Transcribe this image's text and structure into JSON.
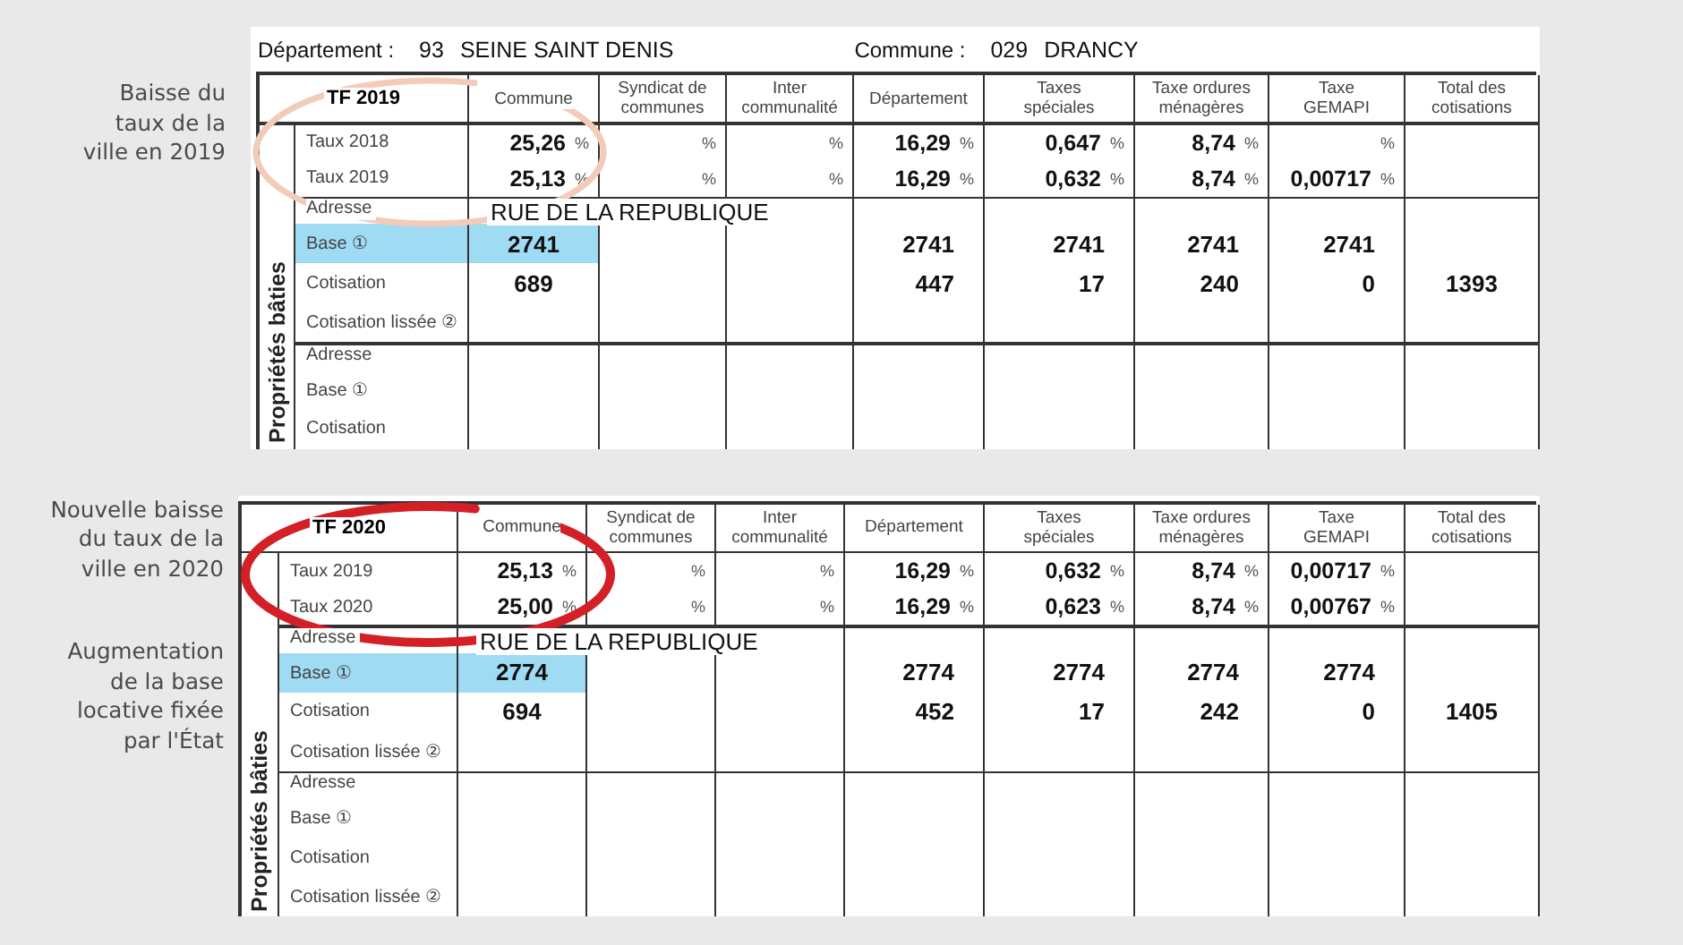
{
  "sections": [
    {
      "annotations": [
        {
          "lines": [
            "Baisse du",
            "taux de la",
            "ville en 2019"
          ]
        }
      ],
      "panel": {
        "header": {
          "departement_label": "Département :",
          "departement_code": "93",
          "departement_name": "SEINE SAINT DENIS",
          "commune_label": "Commune :",
          "commune_code": "029",
          "commune_name": "DRANCY"
        },
        "circle": {
          "color": "#f3cbb9"
        },
        "title": "TF 2019",
        "columns": [
          {
            "lines": [
              "Commune"
            ]
          },
          {
            "lines": [
              "Syndicat de",
              "communes"
            ]
          },
          {
            "lines": [
              "Inter",
              "communalité"
            ]
          },
          {
            "lines": [
              "Département"
            ]
          },
          {
            "lines": [
              "Taxes",
              "spéciales"
            ]
          },
          {
            "lines": [
              "Taxe ordures",
              "ménagères"
            ]
          },
          {
            "lines": [
              "Taxe",
              "GEMAPI"
            ]
          },
          {
            "lines": [
              "Total des",
              "cotisations"
            ]
          }
        ],
        "side_label": "Propriétés bâties",
        "rate_rows": [
          {
            "label": "Taux 2018",
            "cells": [
              {
                "value": "25,26",
                "unit": "%"
              },
              {
                "unit": "%"
              },
              {
                "unit": "%"
              },
              {
                "value": "16,29",
                "unit": "%"
              },
              {
                "value": "0,647",
                "unit": "%"
              },
              {
                "value": "8,74",
                "unit": "%"
              },
              {
                "unit": "%"
              },
              {}
            ]
          },
          {
            "label": "Taux 2019",
            "cells": [
              {
                "value": "25,13",
                "unit": "%"
              },
              {
                "unit": "%"
              },
              {
                "unit": "%"
              },
              {
                "value": "16,29",
                "unit": "%"
              },
              {
                "value": "0,632",
                "unit": "%"
              },
              {
                "value": "8,74",
                "unit": "%"
              },
              {
                "value": "0,00717",
                "unit": "%"
              },
              {}
            ]
          }
        ],
        "blocks": [
          {
            "address_label": "Adresse",
            "address": "RUE DE LA REPUBLIQUE",
            "rows": [
              {
                "label": "Base ①",
                "highlighted": true,
                "cells": [
                  {
                    "value": "2741"
                  },
                  {},
                  {},
                  {
                    "value": "2741"
                  },
                  {
                    "value": "2741"
                  },
                  {
                    "value": "2741"
                  },
                  {
                    "value": "2741"
                  },
                  {}
                ]
              },
              {
                "label": "Cotisation",
                "highlighted": false,
                "cells": [
                  {
                    "value": "689"
                  },
                  {},
                  {},
                  {
                    "value": "447"
                  },
                  {
                    "value": "17"
                  },
                  {
                    "value": "240"
                  },
                  {
                    "value": "0"
                  },
                  {
                    "value": "1393"
                  }
                ]
              },
              {
                "label": "Cotisation lissée ②",
                "highlighted": false
              }
            ]
          },
          {
            "address_label": "Adresse",
            "rows": [
              {
                "label": "Base ①",
                "highlighted": false
              },
              {
                "label": "Cotisation",
                "highlighted": false
              }
            ]
          }
        ]
      }
    },
    {
      "annotations": [
        {
          "lines": [
            "Nouvelle baisse",
            "du taux de la",
            "ville en 2020"
          ]
        },
        {
          "lines": [
            "Augmentation",
            "de la base",
            "locative fixée",
            "par l'État"
          ]
        }
      ],
      "panel": {
        "circle": {
          "color": "#d32027"
        },
        "title": "TF 2020",
        "columns": [
          {
            "lines": [
              "Commune"
            ]
          },
          {
            "lines": [
              "Syndicat de",
              "communes"
            ]
          },
          {
            "lines": [
              "Inter",
              "communalité"
            ]
          },
          {
            "lines": [
              "Département"
            ]
          },
          {
            "lines": [
              "Taxes",
              "spéciales"
            ]
          },
          {
            "lines": [
              "Taxe ordures",
              "ménagères"
            ]
          },
          {
            "lines": [
              "Taxe",
              "GEMAPI"
            ]
          },
          {
            "lines": [
              "Total des",
              "cotisations"
            ]
          }
        ],
        "side_label": "Propriétés bâties",
        "rate_rows": [
          {
            "label": "Taux 2019",
            "cells": [
              {
                "value": "25,13",
                "unit": "%"
              },
              {
                "unit": "%"
              },
              {
                "unit": "%"
              },
              {
                "value": "16,29",
                "unit": "%"
              },
              {
                "value": "0,632",
                "unit": "%"
              },
              {
                "value": "8,74",
                "unit": "%"
              },
              {
                "value": "0,00717",
                "unit": "%"
              },
              {}
            ]
          },
          {
            "label": "Taux 2020",
            "cells": [
              {
                "value": "25,00",
                "unit": "%"
              },
              {
                "unit": "%"
              },
              {
                "unit": "%"
              },
              {
                "value": "16,29",
                "unit": "%"
              },
              {
                "value": "0,623",
                "unit": "%"
              },
              {
                "value": "8,74",
                "unit": "%"
              },
              {
                "value": "0,00767",
                "unit": "%"
              },
              {}
            ]
          }
        ],
        "blocks": [
          {
            "address_label": "Adresse",
            "address": "RUE DE LA REPUBLIQUE",
            "rows": [
              {
                "label": "Base ①",
                "highlighted": true,
                "cells": [
                  {
                    "value": "2774"
                  },
                  {},
                  {},
                  {
                    "value": "2774"
                  },
                  {
                    "value": "2774"
                  },
                  {
                    "value": "2774"
                  },
                  {
                    "value": "2774"
                  },
                  {}
                ]
              },
              {
                "label": "Cotisation",
                "highlighted": false,
                "cells": [
                  {
                    "value": "694"
                  },
                  {},
                  {},
                  {
                    "value": "452"
                  },
                  {
                    "value": "17"
                  },
                  {
                    "value": "242"
                  },
                  {
                    "value": "0"
                  },
                  {
                    "value": "1405"
                  }
                ]
              },
              {
                "label": "Cotisation lissée ②",
                "highlighted": false
              }
            ]
          },
          {
            "address_label": "Adresse",
            "rows": [
              {
                "label": "Base ①",
                "highlighted": false
              },
              {
                "label": "Cotisation",
                "highlighted": false
              },
              {
                "label": "Cotisation lissée ②",
                "highlighted": false
              }
            ]
          }
        ]
      }
    }
  ]
}
